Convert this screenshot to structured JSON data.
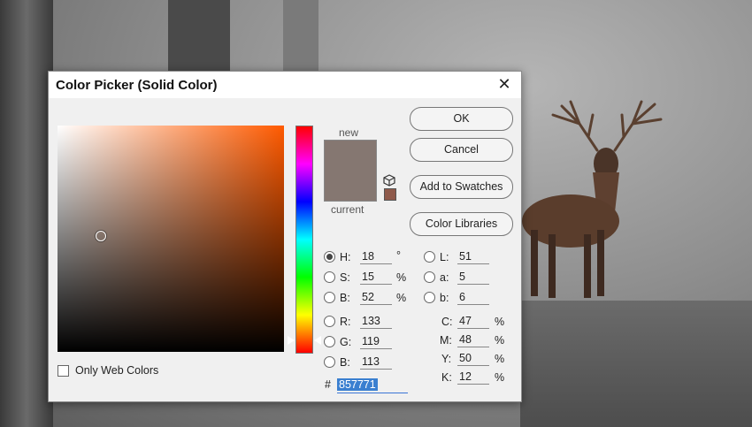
{
  "dialog": {
    "title": "Color Picker (Solid Color)",
    "close_icon": "close-icon"
  },
  "swatch": {
    "new_label": "new",
    "current_label": "current",
    "new_color": "#857771",
    "current_color": "#857771",
    "cube_icon": "cube-icon",
    "web_swatch_color": "#8f5a4b"
  },
  "buttons": {
    "ok": "OK",
    "cancel": "Cancel",
    "add_to_swatches": "Add to Swatches",
    "color_libraries": "Color Libraries"
  },
  "hsb": {
    "h_label": "H:",
    "h_value": "18",
    "h_unit": "°",
    "s_label": "S:",
    "s_value": "15",
    "s_unit": "%",
    "b_label": "B:",
    "b_value": "52",
    "b_unit": "%"
  },
  "rgb": {
    "r_label": "R:",
    "r_value": "133",
    "g_label": "G:",
    "g_value": "119",
    "b_label": "B:",
    "b_value": "113"
  },
  "lab": {
    "l_label": "L:",
    "l_value": "51",
    "a_label": "a:",
    "a_value": "5",
    "b_label": "b:",
    "b_value": "6"
  },
  "cmyk": {
    "c_label": "C:",
    "c_value": "47",
    "c_unit": "%",
    "m_label": "M:",
    "m_value": "48",
    "m_unit": "%",
    "y_label": "Y:",
    "y_value": "50",
    "y_unit": "%",
    "k_label": "K:",
    "k_value": "12",
    "k_unit": "%"
  },
  "hex": {
    "label": "#",
    "value": "857771"
  },
  "web_colors": {
    "label": "Only Web Colors",
    "checked": false
  },
  "colors": {
    "hue_base": "#ff5a00",
    "selection_highlight": "#3a7fd0"
  }
}
